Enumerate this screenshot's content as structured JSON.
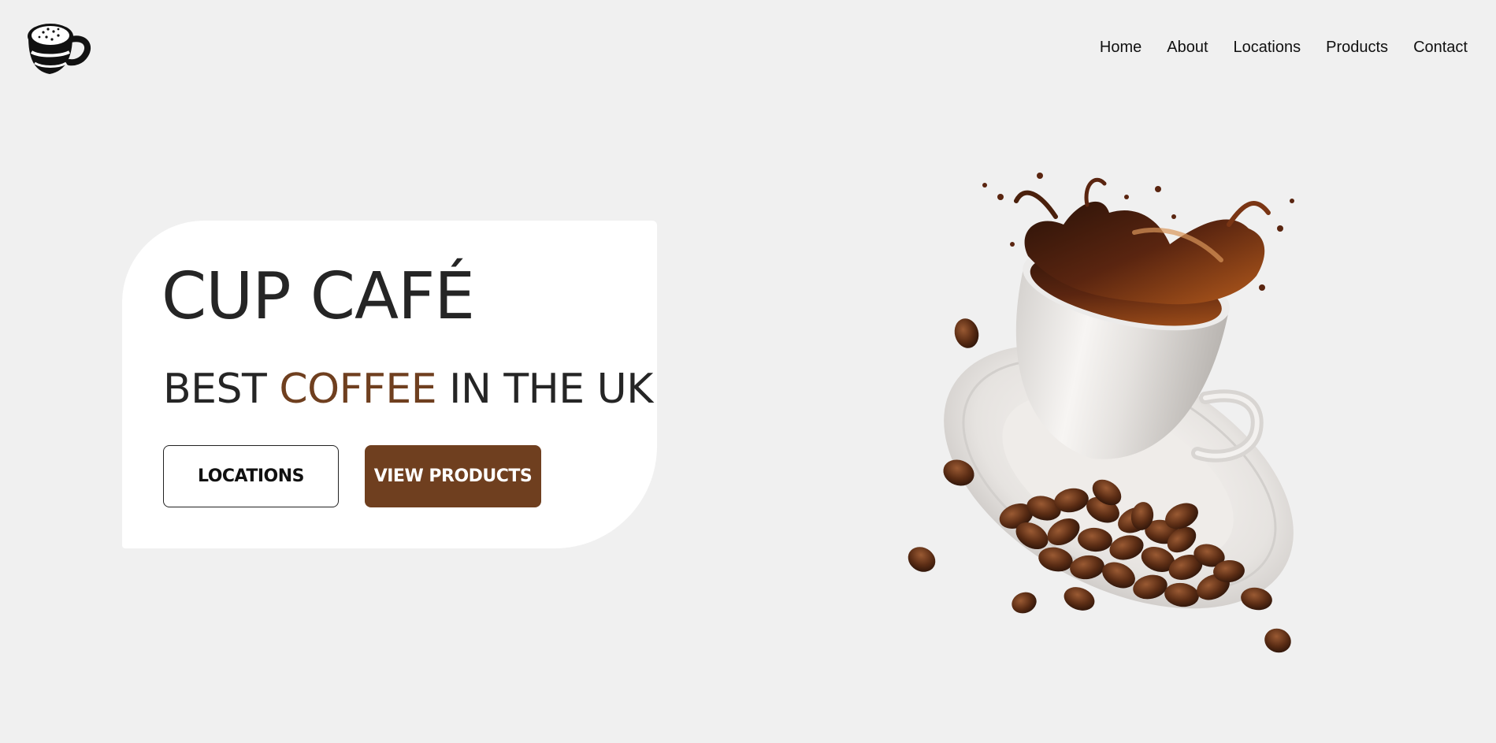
{
  "brand": {
    "logo_icon": "coffee-cup-logo-icon"
  },
  "nav": {
    "items": [
      {
        "label": "Home"
      },
      {
        "label": "About"
      },
      {
        "label": "Locations"
      },
      {
        "label": "Products"
      },
      {
        "label": "Contact"
      }
    ]
  },
  "hero": {
    "title": "CUP CAFÉ",
    "tagline_before": "BEST ",
    "tagline_accent": "COFFEE",
    "tagline_after": " IN THE UK",
    "buttons": {
      "locations_label": "LOCATIONS",
      "products_label": "VIEW PRODUCTS"
    }
  },
  "illustration": {
    "icon": "coffee-splash-illustration"
  },
  "colors": {
    "background": "#f0f0f0",
    "card": "#ffffff",
    "accent": "#6f3f1f",
    "text": "#252525"
  }
}
